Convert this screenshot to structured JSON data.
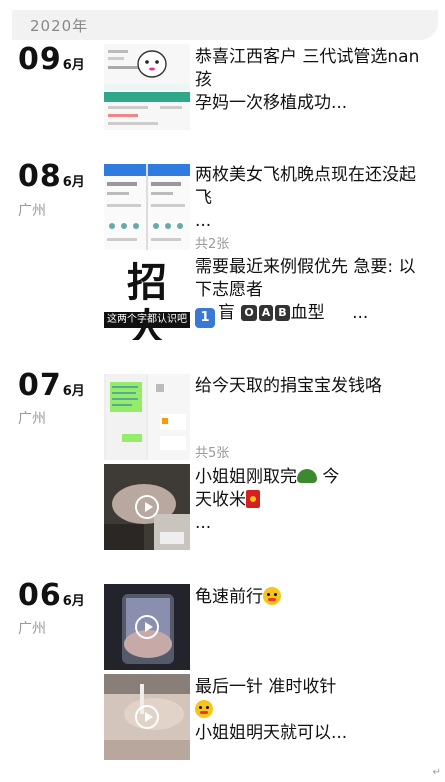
{
  "year": "2020年",
  "days": [
    {
      "day": "09",
      "month": "6月",
      "location": ""
    },
    {
      "day": "08",
      "month": "6月",
      "location": "广州"
    },
    {
      "day": "07",
      "month": "6月",
      "location": "广州"
    },
    {
      "day": "06",
      "month": "6月",
      "location": "广州"
    }
  ],
  "posts": {
    "p1": {
      "text": "恭喜江西客户 三代试管选nan孩\n孕妈一次移植成功..."
    },
    "p2": {
      "text": "两枚美女飞机晚点现在还没起飞\n...",
      "count": "共2张"
    },
    "p3": {
      "line1": "需要最近来例假优先  急要: 以下志愿者",
      "one": "1",
      "blind": "盲",
      "o": "O",
      "a": "A",
      "b": "B",
      "blood": "血型",
      "dots": "...",
      "thumb_big": "招 人",
      "thumb_small": "这两个字都认识吧"
    },
    "p4": {
      "text": "给今天取的捐宝宝发钱咯",
      "count": "共5张"
    },
    "p5": {
      "a": "小姐姐刚取完",
      "b": "  今\n天收米",
      "c": "\n..."
    },
    "p6": {
      "text": "龟速前行"
    },
    "p7": {
      "a": "最后一针   准时收针\n",
      "b": "\n小姐姐明天就可以..."
    }
  },
  "colors": {
    "accent_green": "#07c160",
    "play_white": "#ffffff"
  },
  "corner_mark": "↵"
}
